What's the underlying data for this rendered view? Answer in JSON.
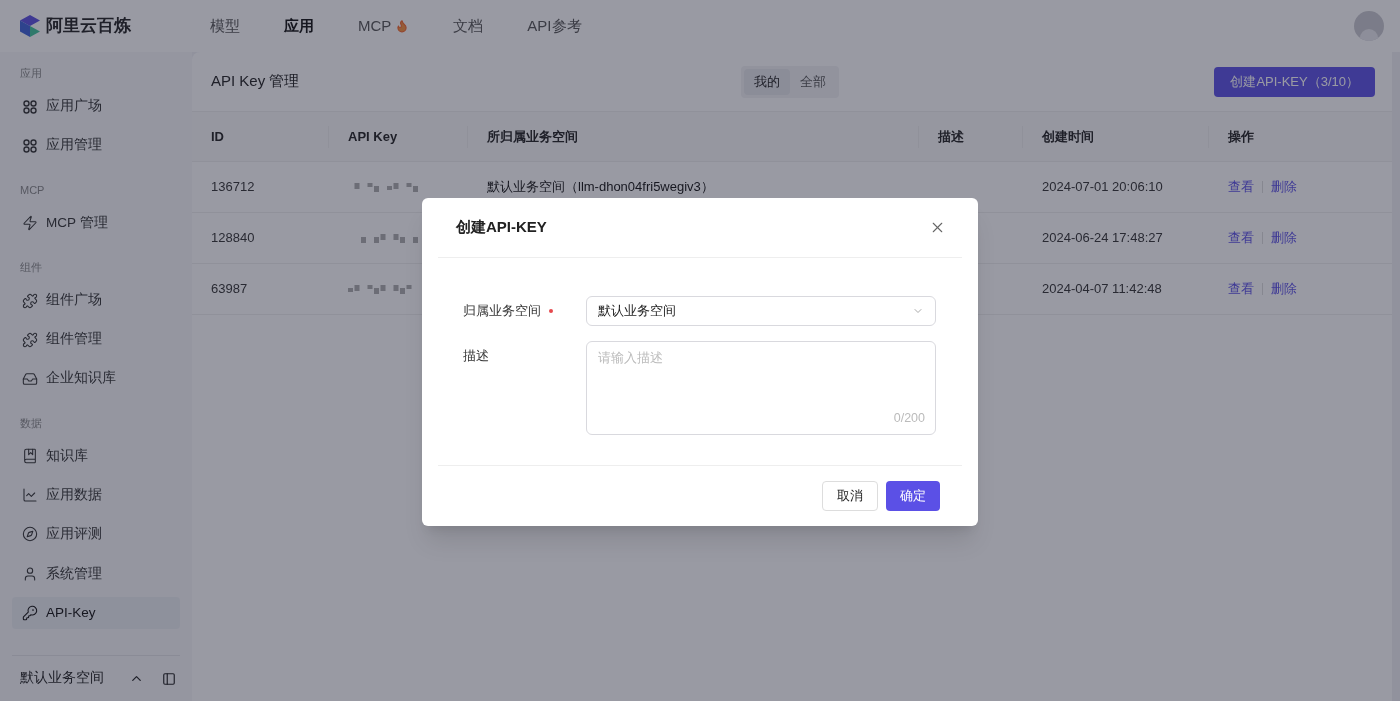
{
  "brand": {
    "name": "阿里云百炼"
  },
  "top_nav": [
    {
      "label": "模型",
      "selected": false,
      "hot": false
    },
    {
      "label": "应用",
      "selected": true,
      "hot": false
    },
    {
      "label": "MCP",
      "selected": false,
      "hot": true
    },
    {
      "label": "文档",
      "selected": false,
      "hot": false
    },
    {
      "label": "API参考",
      "selected": false,
      "hot": false
    }
  ],
  "sidebar": {
    "groups": [
      {
        "label": "应用",
        "items": [
          {
            "label": "应用广场",
            "selected": false
          },
          {
            "label": "应用管理",
            "selected": false
          }
        ]
      },
      {
        "label": "MCP",
        "items": [
          {
            "label": "MCP 管理",
            "selected": false
          }
        ]
      },
      {
        "label": "组件",
        "items": [
          {
            "label": "组件广场",
            "selected": false
          },
          {
            "label": "组件管理",
            "selected": false
          },
          {
            "label": "企业知识库",
            "selected": false
          }
        ]
      },
      {
        "label": "数据",
        "items": [
          {
            "label": "知识库",
            "selected": false
          },
          {
            "label": "应用数据",
            "selected": false
          },
          {
            "label": "应用评测",
            "selected": false
          }
        ]
      },
      {
        "items": [
          {
            "label": "系统管理",
            "selected": false
          },
          {
            "label": "API-Key",
            "selected": true
          }
        ]
      }
    ],
    "workspace": "默认业务空间"
  },
  "page": {
    "title": "API Key 管理",
    "filters": [
      {
        "label": "我的",
        "selected": true
      },
      {
        "label": "全部",
        "selected": false
      }
    ],
    "create_button": "创建API-KEY（3/10）"
  },
  "table": {
    "columns": [
      "ID",
      "API Key",
      "所归属业务空间",
      "描述",
      "创建时间",
      "操作"
    ],
    "rows": [
      {
        "id": "136712",
        "workspace": "默认业务空间（llm-dhon04fri5wegiv3）",
        "created": "2024-07-01 20:06:10",
        "actions": [
          "查看",
          "删除"
        ]
      },
      {
        "id": "128840",
        "created": "2024-06-24 17:48:27",
        "actions": [
          "查看",
          "删除"
        ]
      },
      {
        "id": "63987",
        "created": "2024-04-07 11:42:48",
        "actions": [
          "查看",
          "删除"
        ]
      }
    ]
  },
  "dialog": {
    "title": "创建API-KEY",
    "fields": [
      {
        "kind": "select",
        "label": "归属业务空间",
        "required": true,
        "value": "默认业务空间"
      },
      {
        "kind": "textarea",
        "label": "描述",
        "required": false,
        "placeholder": "请输入描述",
        "counter": "0/200"
      }
    ],
    "buttons": [
      {
        "label": "取消",
        "primary": false
      },
      {
        "label": "确定",
        "primary": true
      }
    ]
  }
}
